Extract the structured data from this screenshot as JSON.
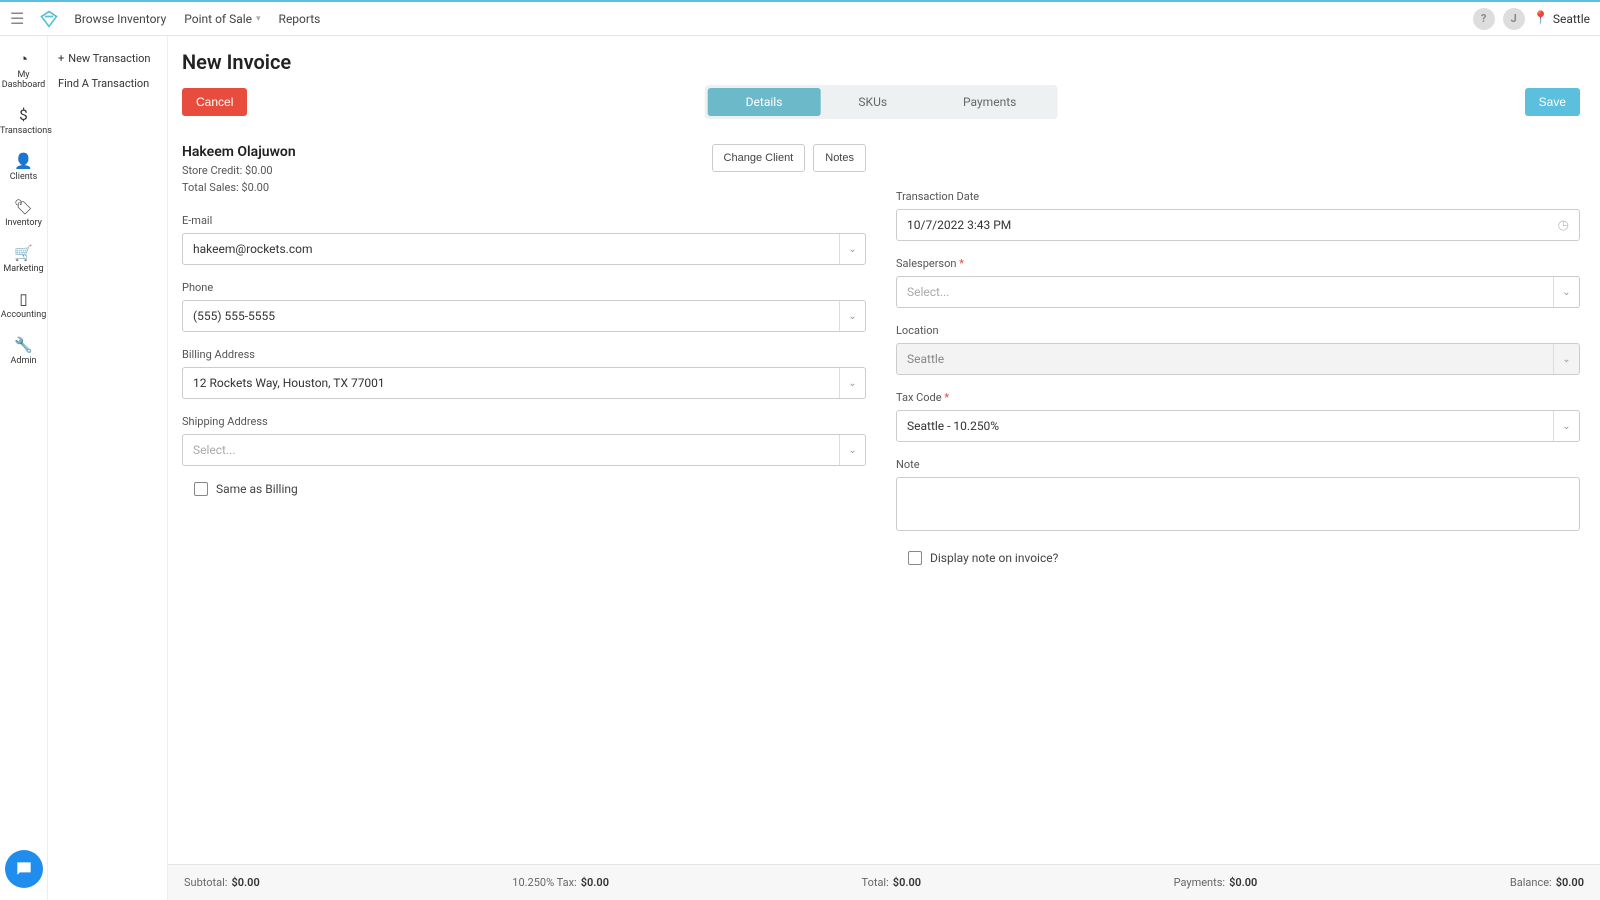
{
  "top_nav": {
    "browse_inventory": "Browse Inventory",
    "point_of_sale": "Point of Sale",
    "reports": "Reports",
    "location": "Seattle"
  },
  "side_nav": {
    "dashboard": "My Dashboard",
    "transactions": "Transactions",
    "clients": "Clients",
    "inventory": "Inventory",
    "marketing": "Marketing",
    "accounting": "Accounting",
    "admin": "Admin"
  },
  "sub_nav": {
    "new_transaction": "New Transaction",
    "find_transaction": "Find A Transaction"
  },
  "page": {
    "title": "New Invoice",
    "cancel": "Cancel",
    "save": "Save",
    "tabs": {
      "details": "Details",
      "skus": "SKUs",
      "payments": "Payments"
    }
  },
  "client": {
    "name": "Hakeem Olajuwon",
    "store_credit_label": "Store Credit:",
    "store_credit_value": "$0.00",
    "total_sales_label": "Total Sales:",
    "total_sales_value": "$0.00",
    "change_client": "Change Client",
    "notes": "Notes"
  },
  "left_fields": {
    "email_label": "E-mail",
    "email_value": "hakeem@rockets.com",
    "phone_label": "Phone",
    "phone_value": "(555) 555-5555",
    "billing_label": "Billing Address",
    "billing_value": "12 Rockets Way, Houston, TX 77001",
    "shipping_label": "Shipping Address",
    "shipping_placeholder": "Select...",
    "same_as_billing": "Same as Billing"
  },
  "right_fields": {
    "trans_date_label": "Transaction Date",
    "trans_date_value": "10/7/2022 3:43 PM",
    "salesperson_label": "Salesperson",
    "salesperson_placeholder": "Select...",
    "location_label": "Location",
    "location_value": "Seattle",
    "tax_label": "Tax Code",
    "tax_value": "Seattle - 10.250%",
    "note_label": "Note",
    "display_note": "Display note on invoice?"
  },
  "footer": {
    "subtotal_label": "Subtotal:",
    "subtotal_value": "$0.00",
    "tax_label": "10.250% Tax:",
    "tax_value": "$0.00",
    "total_label": "Total:",
    "total_value": "$0.00",
    "payments_label": "Payments:",
    "payments_value": "$0.00",
    "balance_label": "Balance:",
    "balance_value": "$0.00"
  }
}
